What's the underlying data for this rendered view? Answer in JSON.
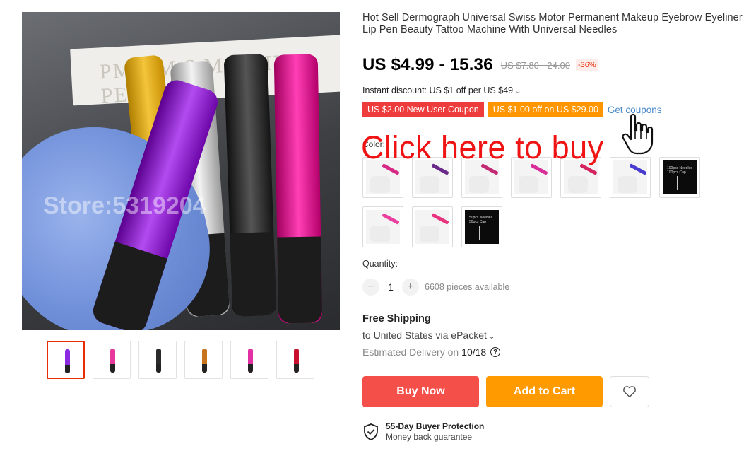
{
  "gallery": {
    "main_image_alt": "Tattoo machine pens",
    "box_text": "PMU/M.S MACHINE PEN",
    "watermark": "Store:5319204",
    "thumbnails": [
      {
        "pen_color": "#8a2be2",
        "active": true
      },
      {
        "pen_color": "#e6399b",
        "active": false
      },
      {
        "pen_color": "#2b2b2b",
        "active": false
      },
      {
        "pen_color": "#c8741c",
        "active": false
      },
      {
        "pen_color": "#e22fa4",
        "active": false
      },
      {
        "pen_color": "#c8102e",
        "active": false
      }
    ]
  },
  "product": {
    "title": "Hot Sell Dermograph Universal Swiss Motor Permanent Makeup Eyebrow Eyeliner Lip Pen Beauty Tattoo Machine With Universal Needles",
    "price": "US $4.99 - 15.36",
    "old_price": "US $7.80 - 24.00",
    "discount_badge": "-36%",
    "instant_discount": "Instant discount: US $1 off per US $49",
    "coupons": {
      "new_user": "US $2.00 New User Coupon",
      "off": "US $1.00 off on US $29.00",
      "get": "Get coupons"
    },
    "color_label": "Color:",
    "swatches": [
      {
        "kind": "photo",
        "pen_color": "#d62a86"
      },
      {
        "kind": "photo",
        "pen_color": "#6a2a8a"
      },
      {
        "kind": "photo",
        "pen_color": "#c42a74"
      },
      {
        "kind": "photo",
        "pen_color": "#d92f9a"
      },
      {
        "kind": "photo",
        "pen_color": "#d3245f"
      },
      {
        "kind": "photo",
        "pen_color": "#4a3ccf"
      },
      {
        "kind": "dark",
        "text": "100pcs Needles\n100pcs Cap"
      },
      {
        "kind": "photo",
        "pen_color": "#ea3f9f"
      },
      {
        "kind": "photo",
        "pen_color": "#e8337e"
      },
      {
        "kind": "dark",
        "text": "50pcs Needles\n50pcs Cap"
      }
    ],
    "quantity_label": "Quantity:",
    "quantity": "1",
    "qty_minus": "−",
    "qty_plus": "+",
    "available": "6608 pieces available",
    "shipping": {
      "title": "Free Shipping",
      "destination": "to United States via ePacket",
      "estimate_label": "Estimated Delivery on",
      "estimate_date": "10/18"
    },
    "buttons": {
      "buy": "Buy Now",
      "cart": "Add to Cart",
      "wishlist_icon": "heart-icon"
    },
    "protection": {
      "title": "55-Day Buyer Protection",
      "subtitle": "Money back guarantee"
    }
  },
  "overlay": {
    "text": "Click here to buy",
    "color": "#ef1313"
  }
}
